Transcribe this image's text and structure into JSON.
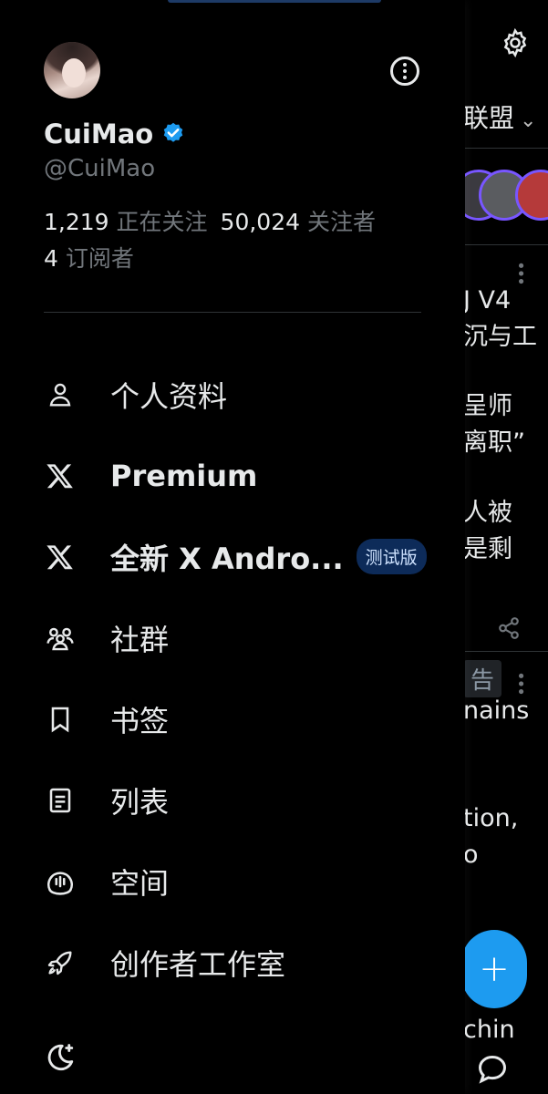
{
  "profile": {
    "display_name": "CuiMao",
    "handle": "@CuiMao",
    "following_count": "1,219",
    "following_label": "正在关注",
    "followers_count": "50,024",
    "followers_label": "关注者",
    "subscribers_count": "4",
    "subscribers_label": "订阅者",
    "verified_color": "#1d9bf0"
  },
  "menu": {
    "items": [
      {
        "label": "个人资料",
        "icon": "person-icon"
      },
      {
        "label": "Premium",
        "icon": "x-logo-icon"
      },
      {
        "label": "全新 X Andro...",
        "icon": "x-logo-icon",
        "badge": "测试版"
      },
      {
        "label": "社群",
        "icon": "communities-icon"
      },
      {
        "label": "书签",
        "icon": "bookmark-icon"
      },
      {
        "label": "列表",
        "icon": "list-icon"
      },
      {
        "label": "空间",
        "icon": "spaces-icon"
      },
      {
        "label": "创作者工作室",
        "icon": "rocket-icon"
      }
    ]
  },
  "background": {
    "filter_label": "联盟",
    "texts": [
      "J V4",
      "沉与工",
      "呈师",
      "离职”",
      "人被",
      "是剩",
      "nains",
      "tion,",
      "o",
      "chin"
    ],
    "ad_label": "告",
    "fab_symbol": "+"
  },
  "colors": {
    "background": "#000000",
    "text": "#e7e9ea",
    "muted": "#71767b",
    "accent": "#1d9bf0",
    "badge_bg": "#0d2b59"
  }
}
